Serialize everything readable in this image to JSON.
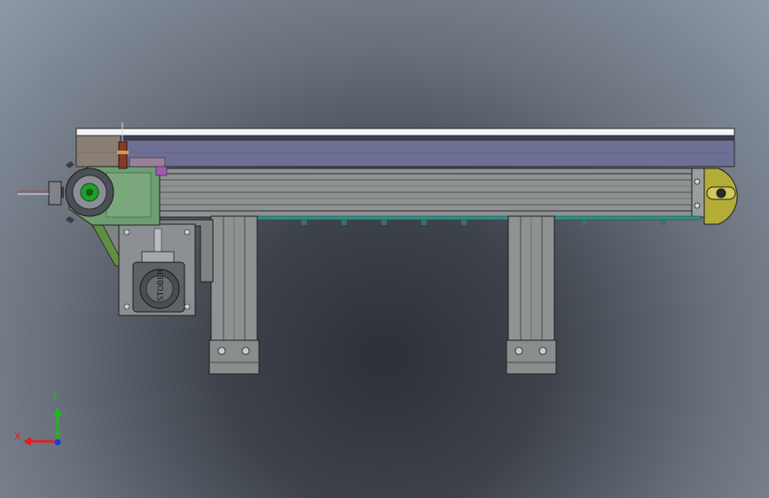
{
  "viewport": {
    "background_top": "#8d99a8",
    "background_bottom": "#2c3037"
  },
  "model": {
    "motor_label": "STOBER",
    "colors": {
      "belt_top": "#f2f4f7",
      "belt_body": "#6e6f94",
      "frame": "#8e9292",
      "drive_bracket": "#6f9d72",
      "tail_pulley": "#b3ad38",
      "motor_housing": "#8c8f94",
      "legs": "#8e9292",
      "return_rail": "#2f8f8c",
      "sensor": "#8b3a2a"
    }
  },
  "triad": {
    "x_label": "X",
    "y_label": "Y",
    "x_color": "#e02020",
    "y_color": "#1fb81f",
    "z_color": "#1f3bd6"
  }
}
